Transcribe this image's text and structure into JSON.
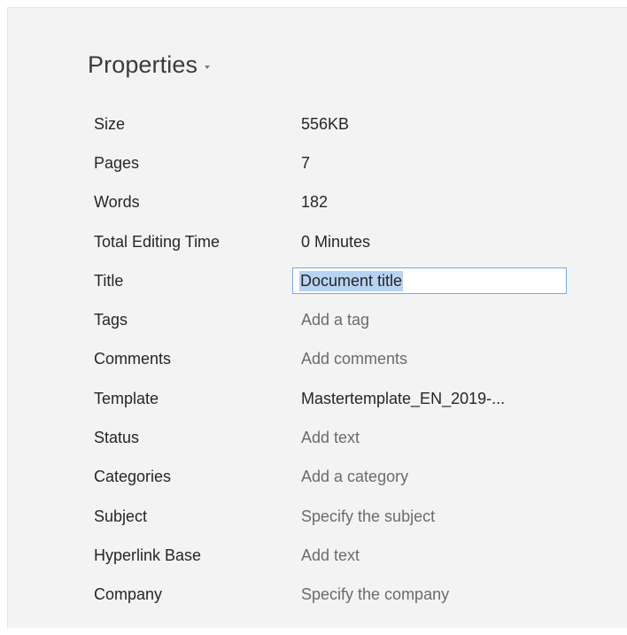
{
  "panel": {
    "header": "Properties"
  },
  "properties": [
    {
      "label": "Size",
      "value": "556KB",
      "placeholder": false
    },
    {
      "label": "Pages",
      "value": "7",
      "placeholder": false
    },
    {
      "label": "Words",
      "value": "182",
      "placeholder": false
    },
    {
      "label": "Total Editing Time",
      "value": "0 Minutes",
      "placeholder": false
    },
    {
      "label": "Title",
      "value": "Document title",
      "placeholder": false,
      "editing": true
    },
    {
      "label": "Tags",
      "value": "Add a tag",
      "placeholder": true
    },
    {
      "label": "Comments",
      "value": "Add comments",
      "placeholder": true
    },
    {
      "label": "Template",
      "value": "Mastertemplate_EN_2019-...",
      "placeholder": false
    },
    {
      "label": "Status",
      "value": "Add text",
      "placeholder": true
    },
    {
      "label": "Categories",
      "value": "Add a category",
      "placeholder": true
    },
    {
      "label": "Subject",
      "value": "Specify the subject",
      "placeholder": true
    },
    {
      "label": "Hyperlink Base",
      "value": "Add text",
      "placeholder": true
    },
    {
      "label": "Company",
      "value": "Specify the company",
      "placeholder": true
    }
  ],
  "colors": {
    "panel_background": "#f3f3f3",
    "selection_highlight": "#b7d3f1",
    "input_border": "#7aa7dc",
    "placeholder_text": "#6b6b6b"
  },
  "icons": {
    "header_dropdown": "caret-down-icon"
  }
}
